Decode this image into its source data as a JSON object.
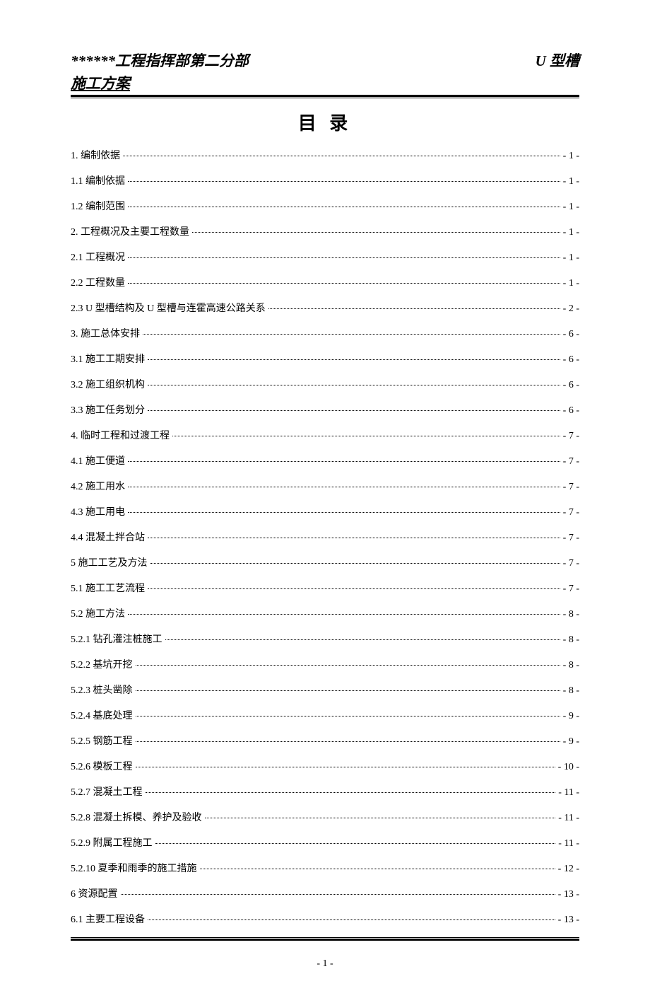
{
  "header": {
    "left": "******工程指挥部第二分部",
    "right": "U 型槽",
    "subtitle": "施工方案"
  },
  "toc_title": "目 录",
  "toc_items": [
    {
      "label": "1. 编制依据",
      "page": "- 1 -"
    },
    {
      "label": "1.1 编制依据",
      "page": "- 1 -"
    },
    {
      "label": "1.2 编制范围",
      "page": "- 1 -"
    },
    {
      "label": "2. 工程概况及主要工程数量",
      "page": "- 1 -"
    },
    {
      "label": "2.1 工程概况",
      "page": "- 1 -"
    },
    {
      "label": "2.2 工程数量",
      "page": "- 1 -"
    },
    {
      "label": "2.3 U 型槽结构及 U 型槽与连霍高速公路关系",
      "page": "- 2 -"
    },
    {
      "label": "3. 施工总体安排",
      "page": "- 6 -"
    },
    {
      "label": "3.1 施工工期安排",
      "page": "- 6 -"
    },
    {
      "label": "3.2 施工组织机构",
      "page": "- 6 -"
    },
    {
      "label": "3.3 施工任务划分",
      "page": "- 6 -"
    },
    {
      "label": "4. 临时工程和过渡工程",
      "page": "- 7 -"
    },
    {
      "label": "4.1 施工便道",
      "page": "- 7 -"
    },
    {
      "label": "4.2 施工用水",
      "page": "- 7 -"
    },
    {
      "label": "4.3 施工用电",
      "page": "- 7 -"
    },
    {
      "label": "4.4 混凝土拌合站",
      "page": "- 7 -"
    },
    {
      "label": "5 施工工艺及方法",
      "page": "- 7 -"
    },
    {
      "label": "5.1 施工工艺流程",
      "page": "- 7 -"
    },
    {
      "label": "5.2 施工方法",
      "page": "- 8 -"
    },
    {
      "label": "5.2.1 钻孔灌注桩施工",
      "page": "- 8 -"
    },
    {
      "label": "5.2.2 基坑开挖",
      "page": "- 8 -"
    },
    {
      "label": "5.2.3 桩头凿除",
      "page": "- 8 -"
    },
    {
      "label": "5.2.4 基底处理",
      "page": "- 9 -"
    },
    {
      "label": "5.2.5 钢筋工程",
      "page": "- 9 -"
    },
    {
      "label": "5.2.6 模板工程",
      "page": "- 10 -"
    },
    {
      "label": "5.2.7 混凝土工程",
      "page": "- 11 -"
    },
    {
      "label": "5.2.8 混凝土拆模、养护及验收",
      "page": "- 11 -"
    },
    {
      "label": "5.2.9 附属工程施工",
      "page": "- 11 -"
    },
    {
      "label": "5.2.10 夏季和雨季的施工措施",
      "page": "- 12 -"
    },
    {
      "label": "6 资源配置",
      "page": "- 13 -"
    },
    {
      "label": "6.1 主要工程设备",
      "page": "- 13 -"
    }
  ],
  "page_number": "- 1 -"
}
